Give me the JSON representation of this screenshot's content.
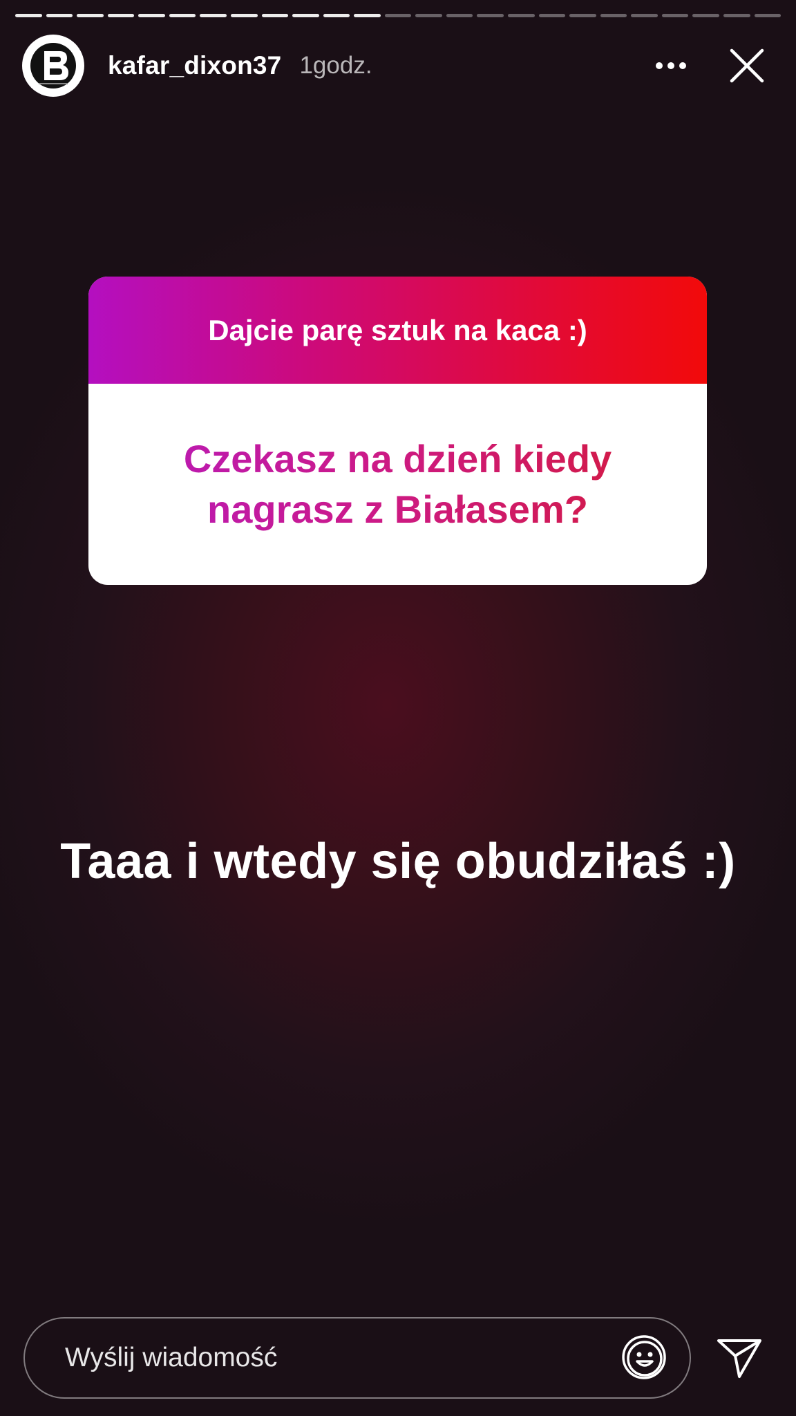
{
  "story": {
    "progress_segments": 25,
    "progress_completed": 12
  },
  "header": {
    "avatar_icon": "brand-logo-b-icon",
    "username": "kafar_dixon37",
    "time": "1godz.",
    "more_icon": "more-dots-icon",
    "close_icon": "close-icon"
  },
  "question_sticker": {
    "prompt": "Dajcie parę sztuk na kaca :)",
    "question": "Czekasz na dzień kiedy nagrasz  z Białasem?",
    "gradient_start": "#b40fc0",
    "gradient_end": "#f20a0a"
  },
  "reply": {
    "text": "Taaa i wtedy się obudziłaś :)"
  },
  "footer": {
    "message_placeholder": "Wyślij wiadomość",
    "sticker_icon": "sticker-smiley-icon",
    "send_icon": "send-paper-plane-icon"
  }
}
